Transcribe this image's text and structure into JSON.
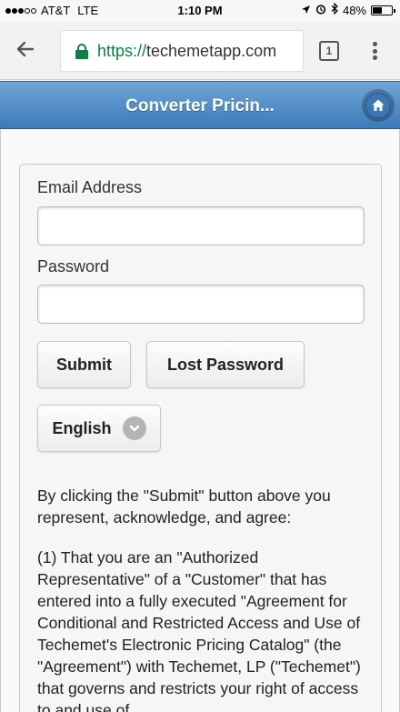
{
  "status_bar": {
    "carrier": "AT&T",
    "network": "LTE",
    "time": "1:10 PM",
    "battery": "48%",
    "battery_level": 0.48
  },
  "browser": {
    "url_scheme": "https://",
    "url_host": "techemetapp.com",
    "tab_count": "1"
  },
  "header": {
    "title": "Converter Pricin..."
  },
  "form": {
    "email_label": "Email Address",
    "email_value": "",
    "password_label": "Password",
    "password_value": "",
    "submit_label": "Submit",
    "lost_password_label": "Lost Password",
    "language_selected": "English"
  },
  "terms": {
    "intro": "By clicking the \"Submit\" button above you represent, acknowledge, and agree:",
    "clause_1": "(1) That you are an \"Authorized Representative\" of a \"Customer\" that has entered into a fully executed \"Agreement for Conditional and Restricted Access and Use of Techemet's Electronic Pricing Catalog\" (the \"Agreement\") with Techemet, LP (\"Techemet\") that governs and restricts your right of access to and use of"
  },
  "colors": {
    "header_gradient_top": "#6fa6d8",
    "header_gradient_bottom": "#3d7ab8",
    "secure_green": "#0b8043"
  }
}
